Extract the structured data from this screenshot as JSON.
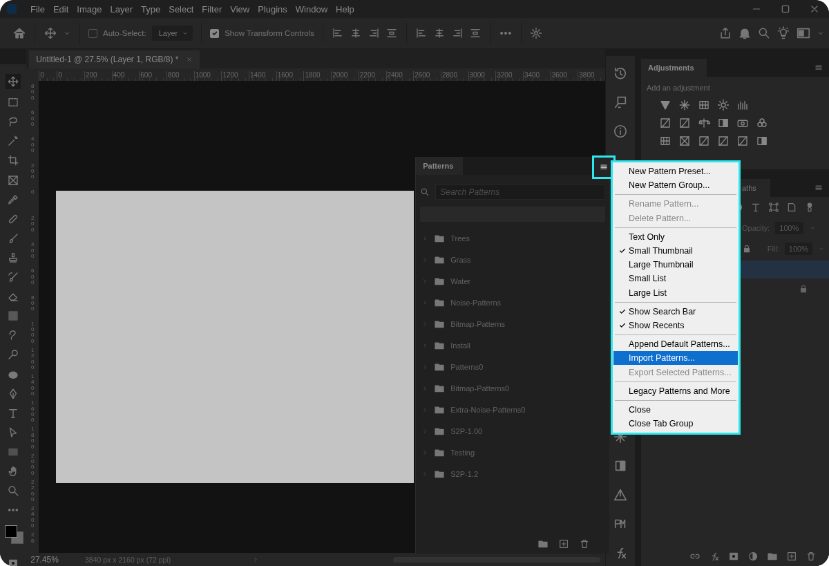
{
  "menu_bar": {
    "items": [
      "File",
      "Edit",
      "Image",
      "Layer",
      "Type",
      "Select",
      "Filter",
      "View",
      "Plugins",
      "Window",
      "Help"
    ]
  },
  "options_bar": {
    "auto_select": {
      "label": "Auto-Select:",
      "checked": false
    },
    "target": "Layer",
    "transform_controls": {
      "label": "Show Transform Controls",
      "checked": true
    }
  },
  "document": {
    "tab_title": "Untitled-1 @ 27.5% (Layer 1, RGB/8) *",
    "ruler_horizontal": [
      "0",
      "0",
      "200",
      "400",
      "600",
      "800",
      "1000",
      "1200",
      "1400",
      "1600",
      "1800",
      "2000",
      "2200",
      "2400",
      "2600",
      "2800",
      "3000",
      "3200",
      "3400",
      "3600",
      "3800"
    ],
    "ruler_vertical": [
      "800",
      "600",
      "400",
      "200",
      "0",
      "200",
      "400",
      "600",
      "800",
      "1000",
      "1200",
      "1400",
      "1600",
      "1800",
      "2000",
      "2200",
      "2400",
      "26"
    ]
  },
  "patterns_panel": {
    "title": "Patterns",
    "search": {
      "placeholder": "Search Patterns"
    },
    "groups": [
      {
        "name": "Trees",
        "expanded": false
      },
      {
        "name": "Grass",
        "expanded": false
      },
      {
        "name": "Water",
        "expanded": false
      },
      {
        "name": "Noise-Patterns",
        "expanded": false
      },
      {
        "name": "Bitmap-Patterns",
        "expanded": false
      },
      {
        "name": "Install",
        "expanded": false
      },
      {
        "name": "Patterns0",
        "expanded": false
      },
      {
        "name": "Bitmap-Patterns0",
        "expanded": false
      },
      {
        "name": "Extra-Noise-Patterns0",
        "expanded": false
      },
      {
        "name": "S2P-1.00",
        "expanded": false
      },
      {
        "name": "Testing",
        "expanded": false
      },
      {
        "name": "S2P-1.2",
        "expanded": false
      }
    ]
  },
  "panel_menu": {
    "sections": [
      {
        "items": [
          {
            "label": "New Pattern Preset...",
            "checked": false,
            "disabled": false,
            "selected": false
          },
          {
            "label": "New Pattern Group...",
            "checked": false,
            "disabled": false,
            "selected": false
          }
        ]
      },
      {
        "items": [
          {
            "label": "Rename Pattern...",
            "checked": false,
            "disabled": true,
            "selected": false
          },
          {
            "label": "Delete Pattern...",
            "checked": false,
            "disabled": true,
            "selected": false
          }
        ]
      },
      {
        "items": [
          {
            "label": "Text Only",
            "checked": false,
            "disabled": false,
            "selected": false
          },
          {
            "label": "Small Thumbnail",
            "checked": true,
            "disabled": false,
            "selected": false
          },
          {
            "label": "Large Thumbnail",
            "checked": false,
            "disabled": false,
            "selected": false
          },
          {
            "label": "Small List",
            "checked": false,
            "disabled": false,
            "selected": false
          },
          {
            "label": "Large List",
            "checked": false,
            "disabled": false,
            "selected": false
          }
        ]
      },
      {
        "items": [
          {
            "label": "Show Search Bar",
            "checked": true,
            "disabled": false,
            "selected": false
          },
          {
            "label": "Show Recents",
            "checked": true,
            "disabled": false,
            "selected": false
          }
        ]
      },
      {
        "items": [
          {
            "label": "Append Default Patterns...",
            "checked": false,
            "disabled": false,
            "selected": false
          },
          {
            "label": "Import Patterns...",
            "checked": false,
            "disabled": false,
            "selected": true
          },
          {
            "label": "Export Selected Patterns...",
            "checked": false,
            "disabled": true,
            "selected": false
          }
        ]
      },
      {
        "items": [
          {
            "label": "Legacy Patterns and More",
            "checked": false,
            "disabled": false,
            "selected": false
          }
        ]
      },
      {
        "items": [
          {
            "label": "Close",
            "checked": false,
            "disabled": false,
            "selected": false
          },
          {
            "label": "Close Tab Group",
            "checked": false,
            "disabled": false,
            "selected": false
          }
        ]
      }
    ]
  },
  "adjustments_panel": {
    "title": "Adjustments",
    "hint": "Add an adjustment"
  },
  "layers_panel": {
    "tab": "aths",
    "opacity_label": "Opacity:",
    "opacity": "100%",
    "fill_label": "Fill:",
    "fill": "100%",
    "layers": [
      {
        "selected": true,
        "locked": false
      },
      {
        "selected": false,
        "locked": true
      }
    ]
  },
  "status_bar": {
    "zoom": "27.45%",
    "doc_info": "3840 px x 2160 px (72 ppi)"
  }
}
